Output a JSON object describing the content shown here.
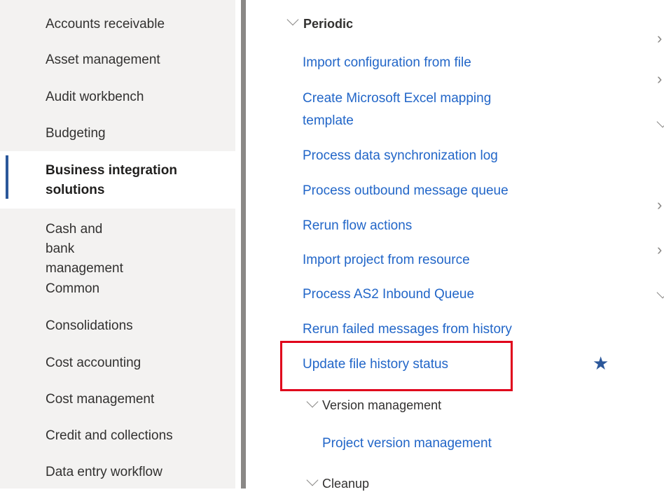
{
  "sidebar": {
    "items": [
      {
        "label": "Accounts receivable"
      },
      {
        "label": "Asset management"
      },
      {
        "label": "Audit workbench"
      },
      {
        "label": "Budgeting"
      },
      {
        "label": "Business integration solutions",
        "active": true
      },
      {
        "label": "Cash and bank management"
      },
      {
        "label": "Common"
      },
      {
        "label": "Consolidations"
      },
      {
        "label": "Cost accounting"
      },
      {
        "label": "Cost management"
      },
      {
        "label": "Credit and collections"
      },
      {
        "label": "Data entry workflow"
      }
    ]
  },
  "main": {
    "section": "Periodic",
    "links": [
      "Import configuration from file",
      "Create Microsoft Excel mapping template",
      "Process data synchronization log",
      "Process outbound message queue",
      "Rerun flow actions",
      "Import project from resource",
      "Process AS2 Inbound Queue",
      "Rerun failed messages from history",
      "Update file history status"
    ],
    "subsections": [
      {
        "label": "Version management",
        "links": [
          "Project version management"
        ]
      },
      {
        "label": "Cleanup"
      }
    ],
    "favorite_icon": "star-icon"
  },
  "colors": {
    "link": "#2266c8",
    "highlight": "#e0001b",
    "accent": "#2b579a"
  }
}
